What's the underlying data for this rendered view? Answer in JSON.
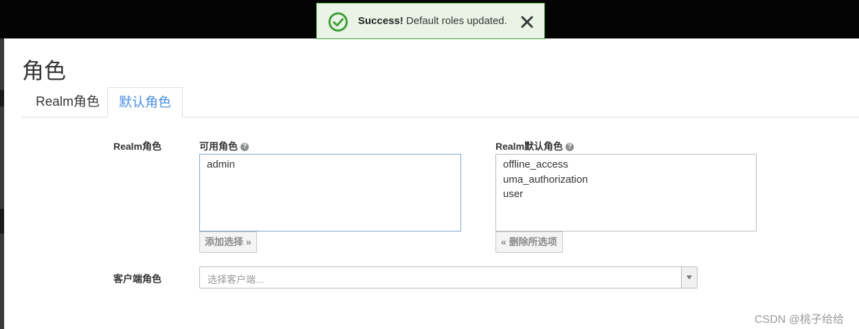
{
  "toast": {
    "title": "Success!",
    "message": "Default roles updated.",
    "icon": "check-circle-icon",
    "close_icon": "close-icon",
    "color": "#3f9c35"
  },
  "page": {
    "title": "角色"
  },
  "tabs": [
    {
      "label": "Realm角色",
      "active": false
    },
    {
      "label": "默认角色",
      "active": true
    }
  ],
  "realm_roles": {
    "section_label": "Realm角色",
    "available": {
      "label": "可用角色",
      "items": [
        "admin"
      ],
      "add_button": "添加选择"
    },
    "default": {
      "label": "Realm默认角色",
      "items": [
        "offline_access",
        "uma_authorization",
        "user"
      ],
      "remove_button": "删除所选项"
    }
  },
  "client_roles": {
    "label": "客户端角色",
    "select_placeholder": "选择客户端..."
  },
  "watermark": "CSDN @桃子给给",
  "colors": {
    "accent": "#4a90e2",
    "topbar": "#030303"
  }
}
